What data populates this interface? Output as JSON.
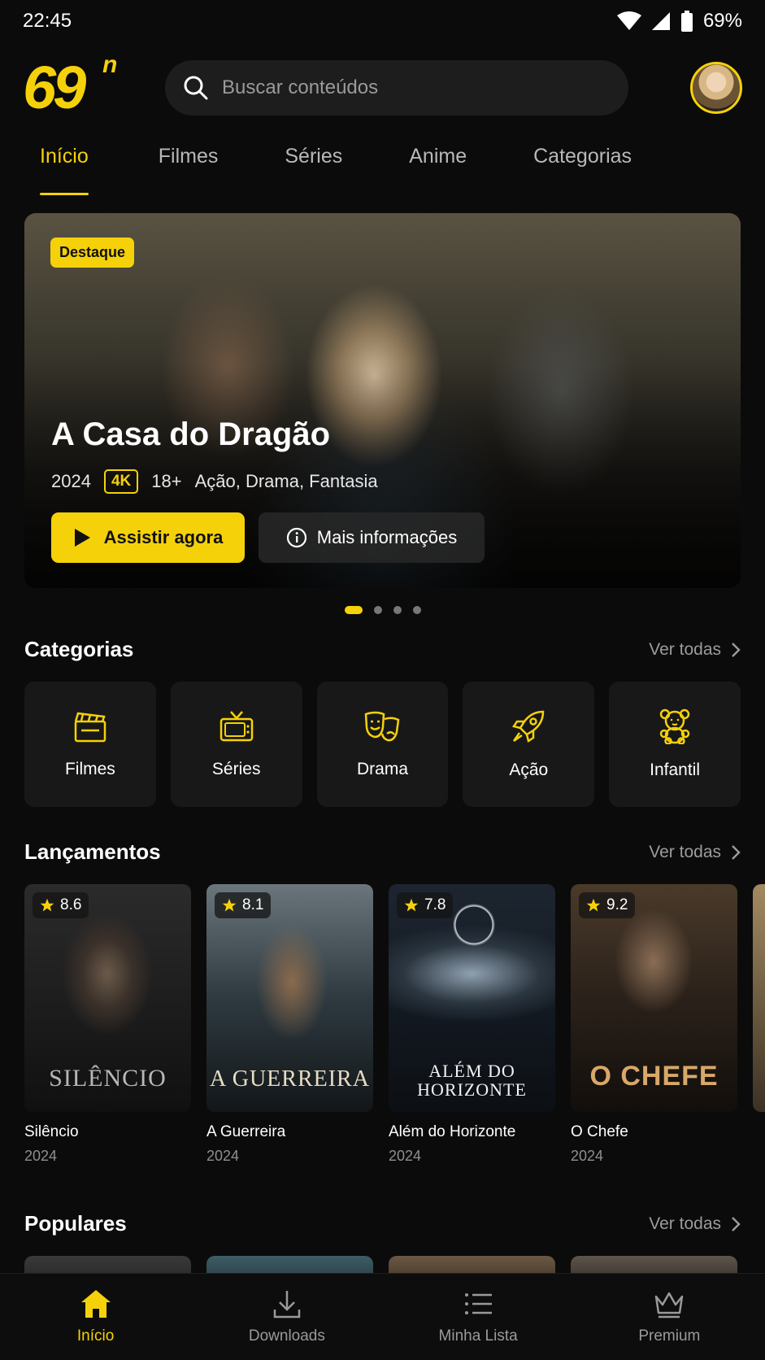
{
  "status_bar": {
    "time": "22:45",
    "battery": "69%"
  },
  "header": {
    "logo_text": "69",
    "logo_sup": "n",
    "search_placeholder": "Buscar conteúdos"
  },
  "tabs": [
    {
      "label": "Início",
      "active": true
    },
    {
      "label": "Filmes"
    },
    {
      "label": "Séries"
    },
    {
      "label": "Anime"
    },
    {
      "label": "Categorias"
    }
  ],
  "hero": {
    "badge": "Destaque",
    "title": "A Casa do Dragão",
    "year": "2024",
    "quality": "4K",
    "age": "18+",
    "genres": "Ação, Drama, Fantasia",
    "watch_label": "Assistir agora",
    "info_label": "Mais informações",
    "page_count": 4,
    "active_page": 1
  },
  "categories": {
    "title": "Categorias",
    "see_all": "Ver todas",
    "items": [
      {
        "label": "Filmes",
        "icon": "clapperboard-icon"
      },
      {
        "label": "Séries",
        "icon": "tv-icon"
      },
      {
        "label": "Drama",
        "icon": "theater-masks-icon"
      },
      {
        "label": "Ação",
        "icon": "rocket-icon"
      },
      {
        "label": "Infantil",
        "icon": "teddy-bear-icon"
      }
    ]
  },
  "releases": {
    "title": "Lançamentos",
    "see_all": "Ver todas",
    "items": [
      {
        "name": "Silêncio",
        "year": "2024",
        "rating": "8.6",
        "poster_text": "SILÊNCIO"
      },
      {
        "name": "A Guerreira",
        "year": "2024",
        "rating": "8.1",
        "poster_text": "A GUERREIRA"
      },
      {
        "name": "Além do Horizonte",
        "year": "2024",
        "rating": "7.8",
        "poster_text": "ALÉM DO HORIZONTE"
      },
      {
        "name": "O Chefe",
        "year": "2024",
        "rating": "9.2",
        "poster_text": "O CHEFE"
      }
    ]
  },
  "popular": {
    "title": "Populares",
    "see_all": "Ver todas"
  },
  "bottom_nav": [
    {
      "label": "Início",
      "icon": "home-icon",
      "active": true
    },
    {
      "label": "Downloads",
      "icon": "download-icon"
    },
    {
      "label": "Minha Lista",
      "icon": "list-icon"
    },
    {
      "label": "Premium",
      "icon": "crown-icon"
    }
  ],
  "colors": {
    "accent": "#f5d10a",
    "background": "#0b0b0b",
    "card": "#181818"
  }
}
